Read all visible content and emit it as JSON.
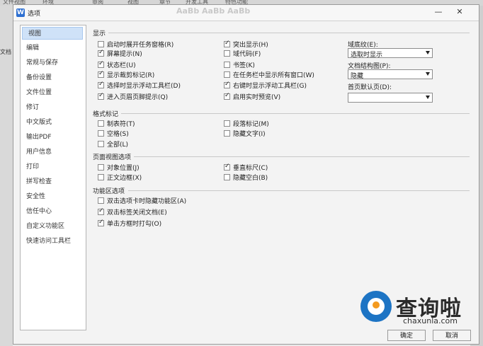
{
  "background": {
    "top_fragments": [
      "文件视图",
      "环境",
      "审阅",
      "视图",
      "章节",
      "开发工具",
      "特色功能"
    ],
    "left_doc_label": "文档"
  },
  "dialog": {
    "title": "选项",
    "app_icon": "W",
    "ribbon_ghost": "AaBb AaBb AaBb",
    "minimize_symbol": "—",
    "close_symbol": "✕"
  },
  "nav": {
    "items": [
      "视图",
      "编辑",
      "常规与保存",
      "备份设置",
      "文件位置",
      "修订",
      "中文版式",
      "输出PDF",
      "用户信息",
      "打印",
      "拼写检查",
      "安全性",
      "信任中心",
      "自定义功能区",
      "快速访问工具栏"
    ],
    "selected_index": 0
  },
  "display": {
    "title": "显示",
    "left": [
      {
        "label": "启动时展开任务窗格(R)",
        "checked": false
      },
      {
        "label": "屏幕提示(N)",
        "checked": true
      },
      {
        "label": "状态栏(U)",
        "checked": true
      },
      {
        "label": "显示裁剪标记(R)",
        "checked": true
      },
      {
        "label": "选择时显示浮动工具栏(D)",
        "checked": true
      },
      {
        "label": "进入页眉页脚提示(Q)",
        "checked": true
      }
    ],
    "right": [
      {
        "label": "突出显示(H)",
        "checked": true
      },
      {
        "label": "域代码(F)",
        "checked": false
      },
      {
        "label": "书签(K)",
        "checked": false
      },
      {
        "label": "在任务栏中显示所有窗口(W)",
        "checked": false
      },
      {
        "label": "右键时显示浮动工具栏(G)",
        "checked": true
      },
      {
        "label": "启用实时预览(V)",
        "checked": true
      }
    ],
    "dropdowns": [
      {
        "label": "域底纹(E):",
        "value": "选取时显示"
      },
      {
        "label": "文档结构图(P):",
        "value": "隐藏"
      },
      {
        "label": "首页默认页(D):",
        "value": ""
      }
    ]
  },
  "format_marks": {
    "title": "格式标记",
    "left": [
      {
        "label": "制表符(T)",
        "checked": false
      },
      {
        "label": "空格(S)",
        "checked": false
      },
      {
        "label": "全部(L)",
        "checked": false
      }
    ],
    "right": [
      {
        "label": "段落标记(M)",
        "checked": false
      },
      {
        "label": "隐藏文字(I)",
        "checked": false
      }
    ]
  },
  "page_view": {
    "title": "页面视图选项",
    "left": [
      {
        "label": "对象位置(J)",
        "checked": false
      },
      {
        "label": "正文边框(X)",
        "checked": false
      }
    ],
    "right": [
      {
        "label": "垂直标尺(C)",
        "checked": true
      },
      {
        "label": "隐藏空白(B)",
        "checked": false
      }
    ]
  },
  "ribbon_opts": {
    "title": "功能区选项",
    "items": [
      {
        "label": "双击选项卡时隐藏功能区(A)",
        "checked": false
      },
      {
        "label": "双击标签关闭文档(E)",
        "checked": true
      },
      {
        "label": "单击方框时打勾(O)",
        "checked": true
      }
    ]
  },
  "buttons": {
    "ok": "确定",
    "cancel": "取消"
  },
  "watermark": {
    "brand": "查询啦",
    "url": "chaxunla.com"
  },
  "colors": {
    "selected_nav": "#cfe2f8",
    "watermark_blue": "#1d74c4",
    "watermark_orange": "#f39a1f"
  }
}
